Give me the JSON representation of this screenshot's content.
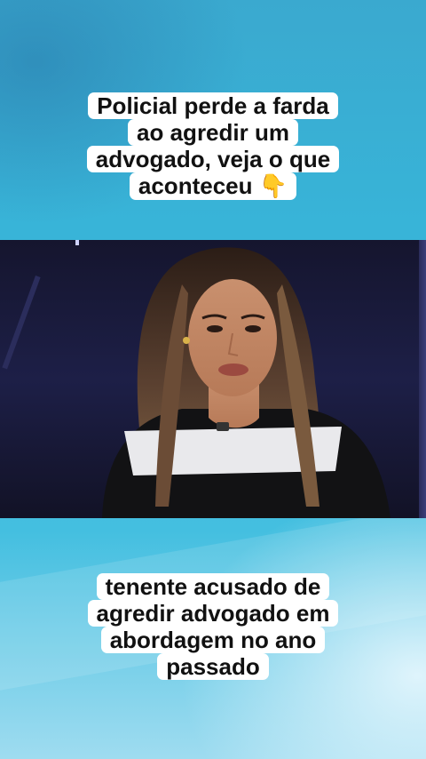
{
  "top_caption": {
    "lines": [
      "Policial perde a farda",
      "ao agredir um",
      "advogado, veja o que",
      "aconteceu"
    ],
    "emoji": "👇"
  },
  "bottom_caption": {
    "lines": [
      "tenente acusado de",
      "agredir advogado em",
      "abordagem no ano",
      "passado"
    ]
  },
  "colors": {
    "background": "#39b6d8",
    "caption_bg": "#ffffff",
    "caption_text": "#111111"
  }
}
